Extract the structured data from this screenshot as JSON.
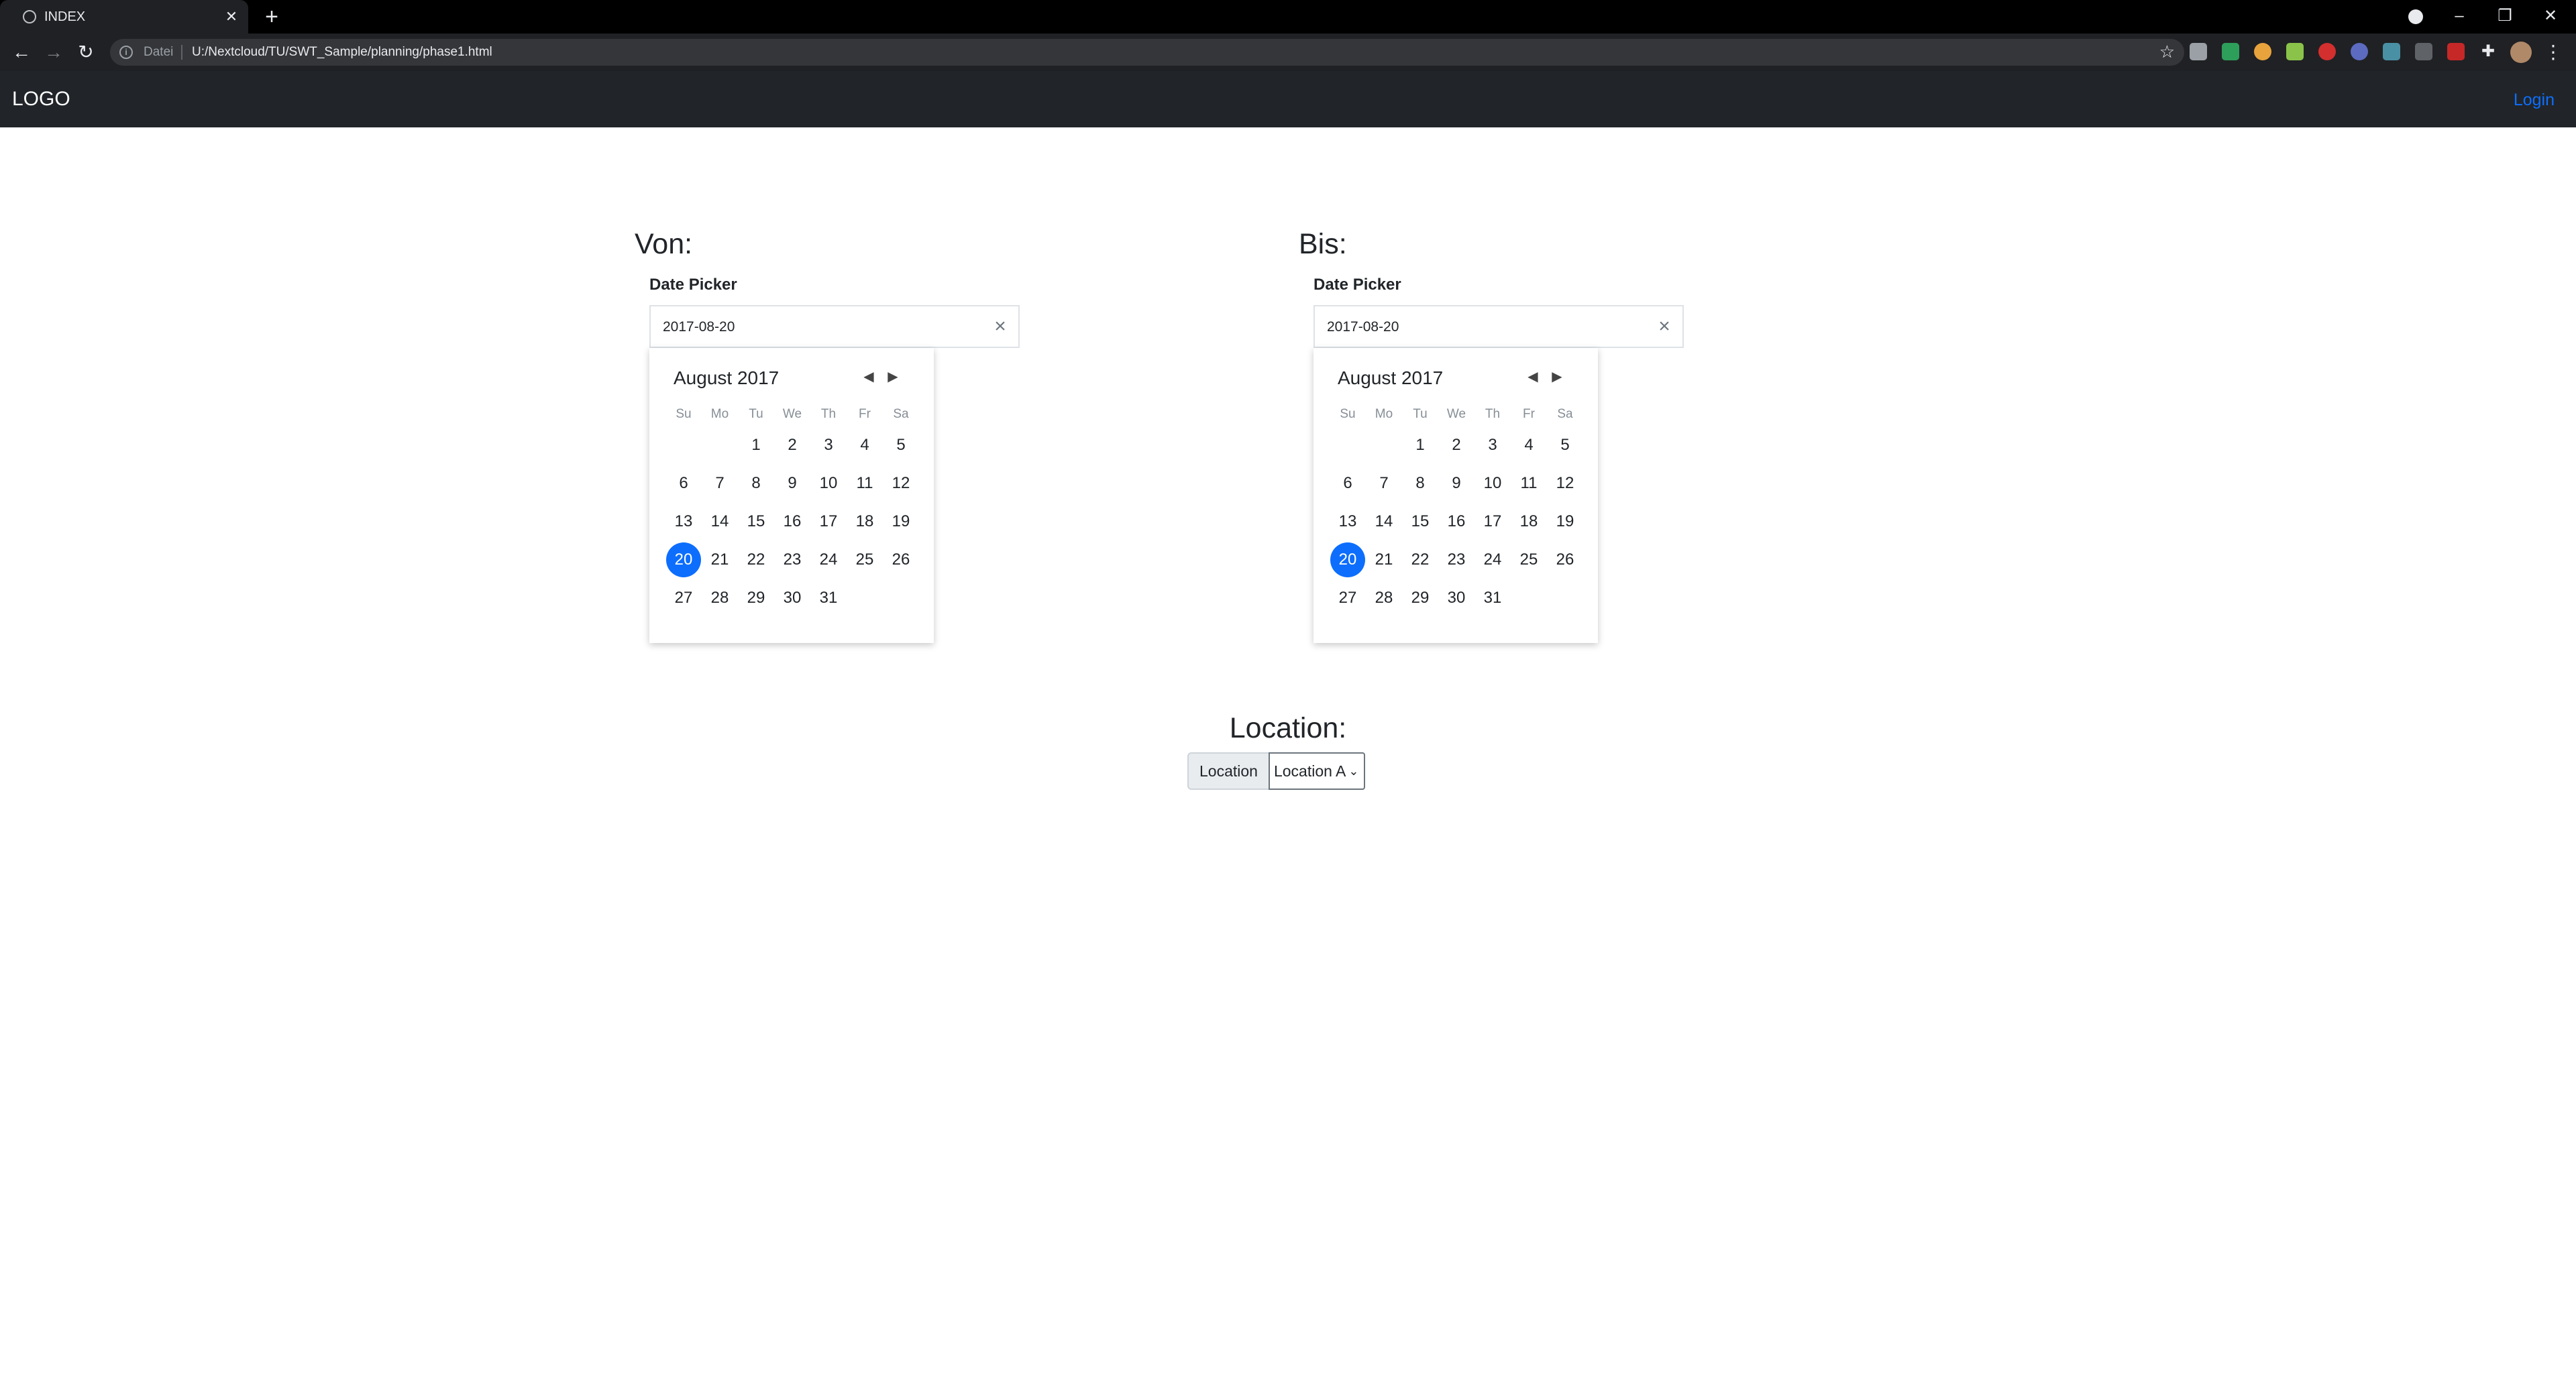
{
  "browser": {
    "tab_title": "INDEX",
    "new_tab": "+",
    "scheme_label": "Datei",
    "url": "U:/Nextcloud/TU/SWT_Sample/planning/phase1.html"
  },
  "navbar": {
    "logo": "LOGO",
    "login": "Login"
  },
  "from_picker": {
    "heading": "Von:",
    "label": "Date Picker",
    "value": "2017-08-20",
    "month_title": "August 2017"
  },
  "to_picker": {
    "heading": "Bis:",
    "label": "Date Picker",
    "value": "2017-08-20",
    "month_title": "August 2017"
  },
  "calendar": {
    "weekdays": [
      "Su",
      "Mo",
      "Tu",
      "We",
      "Th",
      "Fr",
      "Sa"
    ],
    "weeks": [
      [
        "",
        "",
        "1",
        "2",
        "3",
        "4",
        "5"
      ],
      [
        "6",
        "7",
        "8",
        "9",
        "10",
        "11",
        "12"
      ],
      [
        "13",
        "14",
        "15",
        "16",
        "17",
        "18",
        "19"
      ],
      [
        "20",
        "21",
        "22",
        "23",
        "24",
        "25",
        "26"
      ],
      [
        "27",
        "28",
        "29",
        "30",
        "31",
        "",
        ""
      ]
    ],
    "selected_day": "20"
  },
  "location": {
    "heading": "Location:",
    "addon_label": "Location",
    "selected": "Location A"
  },
  "colors": {
    "accent": "#0d6efd",
    "navbar_bg": "#212529"
  }
}
